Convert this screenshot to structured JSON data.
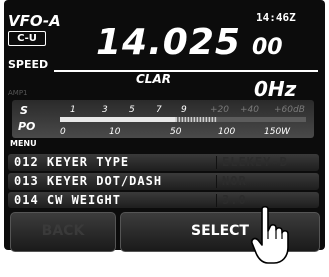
{
  "header": {
    "vfo_label": "VFO-A",
    "mode": "C-U",
    "time": "14:46Z",
    "speed_label": "SPEED",
    "freq_main": "14.025",
    "freq_small": "00",
    "clar_label": "CLAR",
    "clar_value": "0Hz",
    "amp_label": "AMP1"
  },
  "meter": {
    "s_label": "S",
    "po_label": "PO",
    "s_ticks": [
      "1",
      "3",
      "5",
      "7",
      "9",
      "+20",
      "+40",
      "+60dB"
    ],
    "po_ticks": [
      "0",
      "10",
      "50",
      "100",
      "150W"
    ],
    "s_level_fraction": 0.47
  },
  "menu": {
    "title": "MENU",
    "items": [
      {
        "label": "012 KEYER TYPE",
        "value": "ELEKEY-B"
      },
      {
        "label": "013 KEYER DOT/DASH",
        "value": "NOR"
      },
      {
        "label": "014 CW WEIGHT",
        "value": "3.0"
      }
    ]
  },
  "buttons": {
    "back": "BACK",
    "select": "SELECT"
  },
  "colors": {
    "background": "#0c0c0c",
    "text": "#ffffff",
    "dim_text": "#2c2c2c"
  }
}
